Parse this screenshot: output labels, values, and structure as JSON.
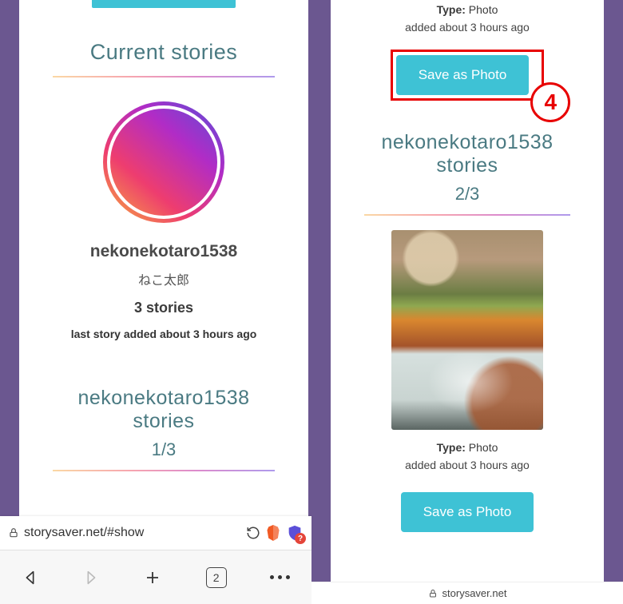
{
  "left": {
    "heading": "Current stories",
    "profile": {
      "username": "nekonekotaro1538",
      "display_name_jp": "ねこ太郎",
      "story_count_label": "3 stories",
      "last_story_label": "last story added about 3 hours ago"
    },
    "stories_header": "nekonekotaro1538 stories",
    "story_index": "1/3",
    "url": "storysaver.net/#show",
    "tab_count": "2"
  },
  "right": {
    "top_meta": {
      "type_label": "Type: ",
      "type_value": "Photo",
      "added": "added about 3 hours ago"
    },
    "save_button": "Save as Photo",
    "annotation_number": "4",
    "stories_header": "nekonekotaro1538 stories",
    "story_index": "2/3",
    "bottom_meta": {
      "type_label": "Type: ",
      "type_value": "Photo",
      "added": "added about 3 hours ago"
    },
    "save_button2": "Save as Photo",
    "bottom_url": "storysaver.net"
  },
  "colors": {
    "accent": "#3ec2d5",
    "purple": "#6b5790",
    "highlight": "#e80000"
  }
}
